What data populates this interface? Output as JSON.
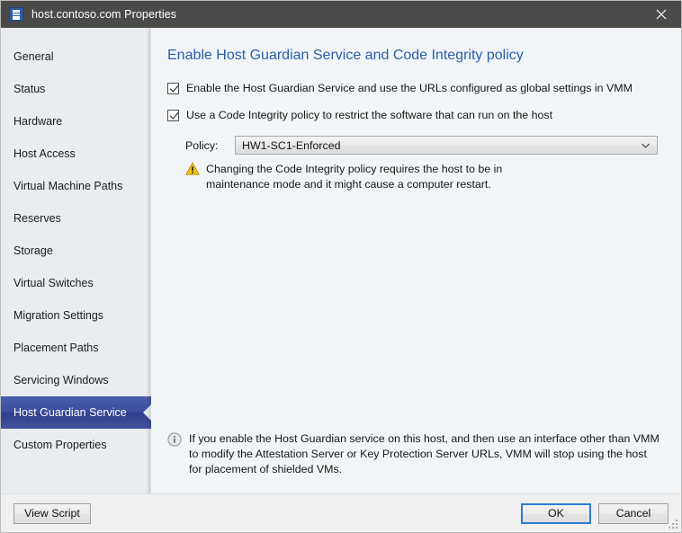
{
  "window": {
    "title": "host.contoso.com Properties",
    "app_icon": "server-properties-icon",
    "close_icon": "close-icon"
  },
  "sidebar": {
    "items": [
      {
        "label": "General",
        "selected": false
      },
      {
        "label": "Status",
        "selected": false
      },
      {
        "label": "Hardware",
        "selected": false
      },
      {
        "label": "Host Access",
        "selected": false
      },
      {
        "label": "Virtual Machine Paths",
        "selected": false
      },
      {
        "label": "Reserves",
        "selected": false
      },
      {
        "label": "Storage",
        "selected": false
      },
      {
        "label": "Virtual Switches",
        "selected": false
      },
      {
        "label": "Migration Settings",
        "selected": false
      },
      {
        "label": "Placement Paths",
        "selected": false
      },
      {
        "label": "Servicing Windows",
        "selected": false
      },
      {
        "label": "Host Guardian Service",
        "selected": true
      },
      {
        "label": "Custom Properties",
        "selected": false
      }
    ]
  },
  "content": {
    "title": "Enable Host Guardian Service and Code Integrity policy",
    "checkbox_hgs": {
      "label": "Enable the Host Guardian Service and use the URLs configured as global settings in VMM",
      "checked": true
    },
    "checkbox_code_integrity": {
      "label": "Use a Code Integrity policy to restrict the software that can run on the host",
      "checked": true
    },
    "policy": {
      "label": "Policy:",
      "value": "HW1-SC1-Enforced",
      "arrow_icon": "chevron-down-icon"
    },
    "warning": {
      "icon": "warning-triangle-icon",
      "text": "Changing the Code Integrity policy requires the host to be in maintenance mode and it might cause a computer restart."
    },
    "info": {
      "icon": "info-circle-icon",
      "text": "If you enable the Host Guardian service on this host, and then use an interface other than VMM to modify the Attestation Server or Key Protection Server URLs, VMM will stop using the host for placement of shielded VMs."
    }
  },
  "footer": {
    "view_script_label": "View Script",
    "ok_label": "OK",
    "cancel_label": "Cancel",
    "resize_grip_icon": "resize-grip-icon"
  },
  "colors": {
    "titlebar_bg": "#4a4a48",
    "selection_blue": "#3a4d9c",
    "heading_blue": "#2a5daa",
    "focus_blue": "#2b7cd3",
    "warning_yellow": "#f5c518",
    "sidebar_bg": "#e9edf0",
    "content_bg": "#f2f5f7"
  }
}
